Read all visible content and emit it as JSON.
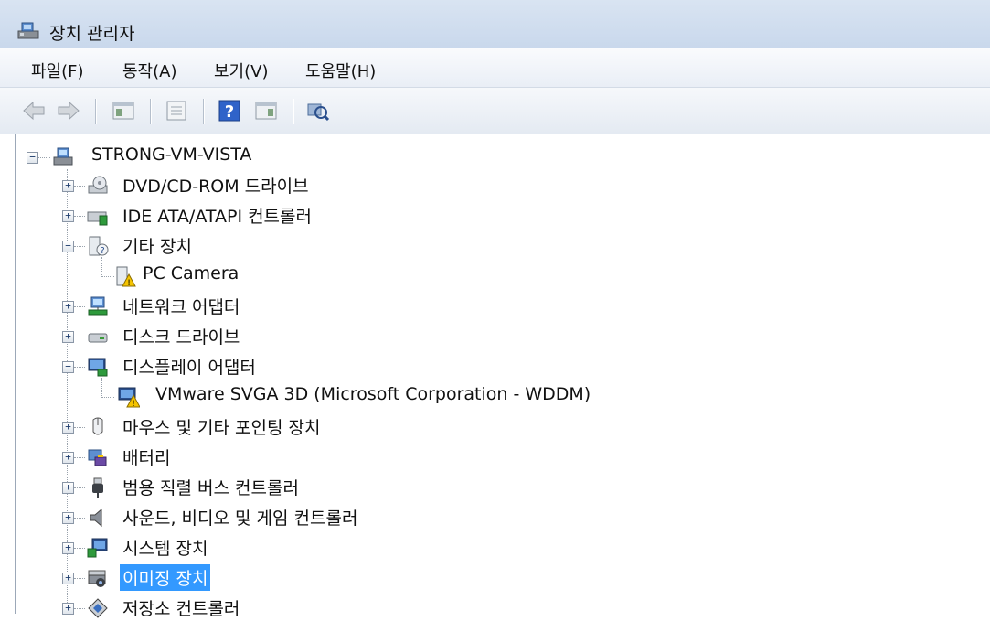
{
  "window": {
    "title": "장치 관리자"
  },
  "menu": [
    {
      "label": "파일(F)"
    },
    {
      "label": "동작(A)"
    },
    {
      "label": "보기(V)"
    },
    {
      "label": "도움말(H)"
    }
  ],
  "toolbar": {
    "buttons": [
      "back-icon",
      "forward-icon",
      "show-hide-console-tree-icon",
      "properties-icon",
      "help-icon",
      "action-pane-icon",
      "scan-hardware-icon"
    ]
  },
  "tree": {
    "root": "STRONG-VM-VISTA",
    "items": [
      {
        "label": "DVD/CD-ROM 드라이브",
        "expander": "+"
      },
      {
        "label": "IDE ATA/ATAPI 컨트롤러",
        "expander": "+"
      },
      {
        "label": "기타 장치",
        "expander": "−"
      },
      {
        "label": "PC Camera",
        "expander": ""
      },
      {
        "label": "네트워크 어댑터",
        "expander": "+"
      },
      {
        "label": "디스크 드라이브",
        "expander": "+"
      },
      {
        "label": "디스플레이 어댑터",
        "expander": "−"
      },
      {
        "label": "VMware SVGA 3D (Microsoft Corporation - WDDM)",
        "expander": ""
      },
      {
        "label": "마우스 및 기타 포인팅 장치",
        "expander": "+"
      },
      {
        "label": "배터리",
        "expander": "+"
      },
      {
        "label": "범용 직렬 버스 컨트롤러",
        "expander": "+"
      },
      {
        "label": "사운드, 비디오 및 게임 컨트롤러",
        "expander": "+"
      },
      {
        "label": "시스템 장치",
        "expander": "+"
      },
      {
        "label": "이미징 장치",
        "expander": "+",
        "selected": true
      },
      {
        "label": "저장소 컨트롤러",
        "expander": "+"
      }
    ]
  }
}
